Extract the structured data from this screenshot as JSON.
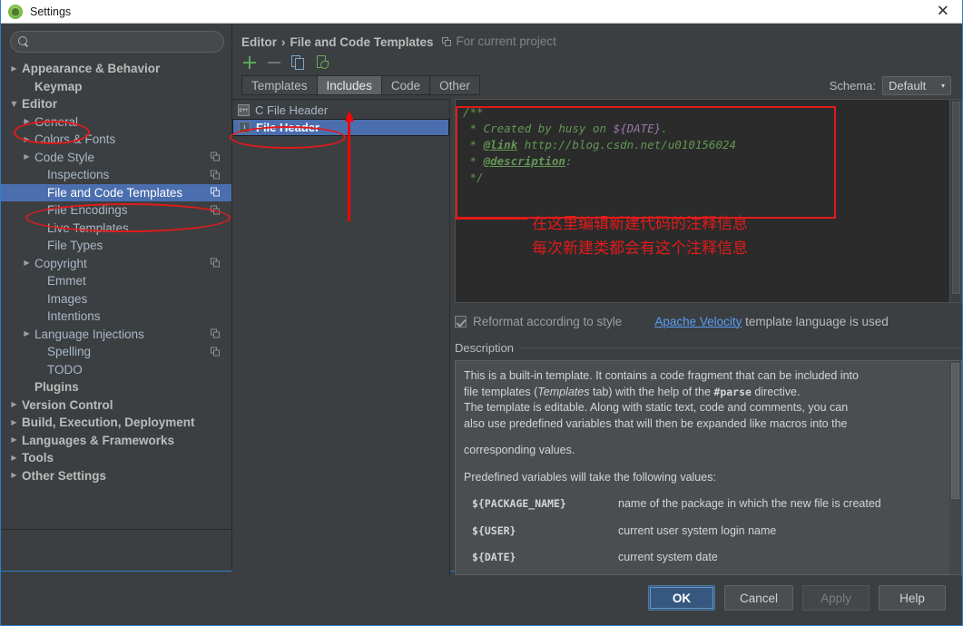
{
  "window": {
    "title": "Settings",
    "close_label": "✕",
    "app_icon": "android-studio-icon"
  },
  "sidebar": {
    "search": {
      "value": "",
      "placeholder": ""
    },
    "items": [
      {
        "label": "Appearance & Behavior",
        "arrow": "▶",
        "bold": true,
        "indent": 0,
        "copy": false,
        "selected": false
      },
      {
        "label": "Keymap",
        "arrow": "",
        "bold": true,
        "indent": 1,
        "copy": false,
        "selected": false
      },
      {
        "label": "Editor",
        "arrow": "▼",
        "bold": true,
        "indent": 0,
        "copy": false,
        "selected": false
      },
      {
        "label": "General",
        "arrow": "▶",
        "bold": false,
        "indent": 1,
        "copy": false,
        "selected": false
      },
      {
        "label": "Colors & Fonts",
        "arrow": "▶",
        "bold": false,
        "indent": 1,
        "copy": false,
        "selected": false
      },
      {
        "label": "Code Style",
        "arrow": "▶",
        "bold": false,
        "indent": 1,
        "copy": true,
        "selected": false
      },
      {
        "label": "Inspections",
        "arrow": "",
        "bold": false,
        "indent": 2,
        "copy": true,
        "selected": false
      },
      {
        "label": "File and Code Templates",
        "arrow": "",
        "bold": false,
        "indent": 2,
        "copy": true,
        "selected": true
      },
      {
        "label": "File Encodings",
        "arrow": "",
        "bold": false,
        "indent": 2,
        "copy": true,
        "selected": false
      },
      {
        "label": "Live Templates",
        "arrow": "",
        "bold": false,
        "indent": 2,
        "copy": false,
        "selected": false
      },
      {
        "label": "File Types",
        "arrow": "",
        "bold": false,
        "indent": 2,
        "copy": false,
        "selected": false
      },
      {
        "label": "Copyright",
        "arrow": "▶",
        "bold": false,
        "indent": 1,
        "copy": true,
        "selected": false
      },
      {
        "label": "Emmet",
        "arrow": "",
        "bold": false,
        "indent": 2,
        "copy": false,
        "selected": false
      },
      {
        "label": "Images",
        "arrow": "",
        "bold": false,
        "indent": 2,
        "copy": false,
        "selected": false
      },
      {
        "label": "Intentions",
        "arrow": "",
        "bold": false,
        "indent": 2,
        "copy": false,
        "selected": false
      },
      {
        "label": "Language Injections",
        "arrow": "▶",
        "bold": false,
        "indent": 1,
        "copy": true,
        "selected": false
      },
      {
        "label": "Spelling",
        "arrow": "",
        "bold": false,
        "indent": 2,
        "copy": true,
        "selected": false
      },
      {
        "label": "TODO",
        "arrow": "",
        "bold": false,
        "indent": 2,
        "copy": false,
        "selected": false
      },
      {
        "label": "Plugins",
        "arrow": "",
        "bold": true,
        "indent": 1,
        "copy": false,
        "selected": false
      },
      {
        "label": "Version Control",
        "arrow": "▶",
        "bold": true,
        "indent": 0,
        "copy": false,
        "selected": false
      },
      {
        "label": "Build, Execution, Deployment",
        "arrow": "▶",
        "bold": true,
        "indent": 0,
        "copy": false,
        "selected": false
      },
      {
        "label": "Languages & Frameworks",
        "arrow": "▶",
        "bold": true,
        "indent": 0,
        "copy": false,
        "selected": false
      },
      {
        "label": "Tools",
        "arrow": "▶",
        "bold": true,
        "indent": 0,
        "copy": false,
        "selected": false
      },
      {
        "label": "Other Settings",
        "arrow": "▶",
        "bold": true,
        "indent": 0,
        "copy": false,
        "selected": false
      }
    ]
  },
  "main": {
    "breadcrumb": {
      "parent": "Editor",
      "separator": "›",
      "current": "File and Code Templates",
      "scope": "For current project"
    },
    "schema": {
      "label": "Schema:",
      "value": "Default",
      "caret": "▾"
    },
    "toolbar": {
      "add_label": "+",
      "remove_label": "−",
      "copy_label": "copy-template",
      "reset_label": "reset-to-default"
    },
    "tabs": [
      {
        "label": "Templates",
        "active": false
      },
      {
        "label": "Includes",
        "active": true
      },
      {
        "label": "Code",
        "active": false
      },
      {
        "label": "Other",
        "active": false
      }
    ],
    "templates": [
      {
        "label": "C File Header",
        "icon": "c++",
        "selected": false
      },
      {
        "label": "File Header",
        "icon": "i",
        "selected": true
      }
    ],
    "editor": {
      "lines": [
        [
          {
            "t": "/**",
            "s": "plain"
          }
        ],
        [
          {
            "t": " * Created by husy on ",
            "s": "plain"
          },
          {
            "t": "${DATE}",
            "s": "var"
          },
          {
            "t": ".",
            "s": "plain"
          }
        ],
        [
          {
            "t": " * ",
            "s": "plain"
          },
          {
            "t": "@link",
            "s": "tagdoc"
          },
          {
            "t": " http://blog.csdn.net/u010156024",
            "s": "plain"
          }
        ],
        [
          {
            "t": " * ",
            "s": "plain"
          },
          {
            "t": "@description",
            "s": "tagdoc"
          },
          {
            "t": ":",
            "s": "plain"
          }
        ],
        [
          {
            "t": " */",
            "s": "plain"
          }
        ]
      ]
    },
    "reformat": {
      "checked": true,
      "label": "Reformat according to style"
    },
    "velocity": {
      "link": "Apache Velocity",
      "suffix": " template language is used"
    },
    "description": {
      "title": "Description",
      "paragraphs": [
        "This is a built-in template. It contains a code fragment that can be included into",
        "file templates (Templates tab) with the help of the #parse directive.",
        "The template is editable. Along with static text, code and comments, you can",
        "also use predefined variables that will then be expanded like macros into the",
        "corresponding values."
      ],
      "p_emphasis": "Templates",
      "p_mono": "#parse",
      "variables_intro": "Predefined variables will take the following values:",
      "variables": [
        {
          "name": "${PACKAGE_NAME}",
          "desc": "name of the package in which the new file is created"
        },
        {
          "name": "${USER}",
          "desc": "current user system login name"
        },
        {
          "name": "${DATE}",
          "desc": "current system date"
        }
      ]
    }
  },
  "buttons": [
    {
      "label": "OK",
      "style": "default"
    },
    {
      "label": "Cancel",
      "style": "normal"
    },
    {
      "label": "Apply",
      "style": "disabled"
    },
    {
      "label": "Help",
      "style": "normal"
    }
  ],
  "annotations": {
    "cn_line1": "在这里编辑新建代码的注释信息",
    "cn_line2": "每次新建类都会有这个注释信息",
    "accent_color": "#e01b1b"
  }
}
